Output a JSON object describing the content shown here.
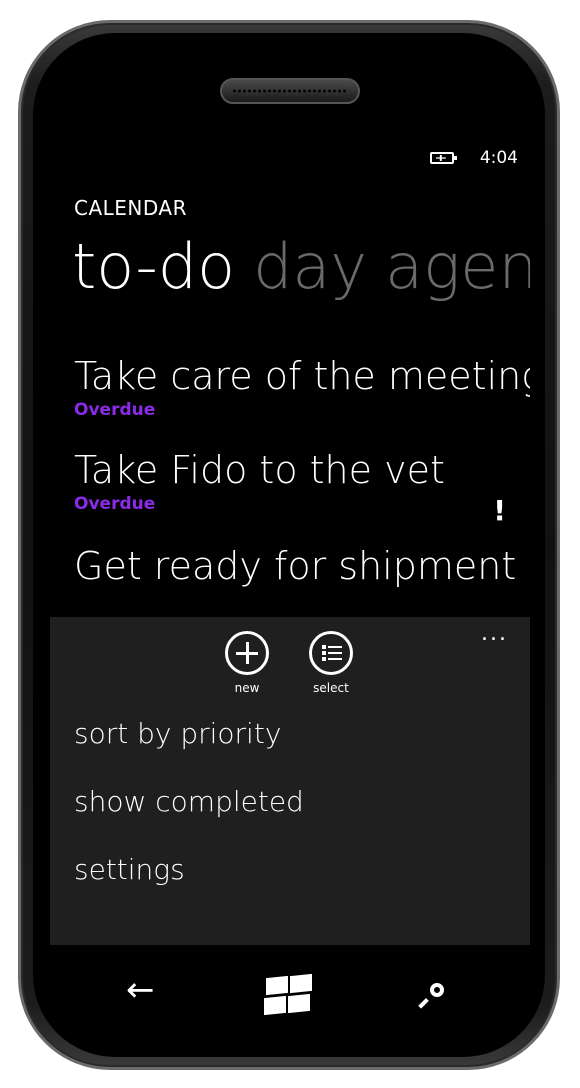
{
  "status_bar": {
    "battery_icon": "battery-charging-icon",
    "time": "4:04"
  },
  "app": {
    "title": "CALENDAR"
  },
  "pivots": [
    {
      "label": "to-do",
      "active": true
    },
    {
      "label": "day",
      "active": false
    },
    {
      "label": "agen",
      "active": false
    }
  ],
  "tasks": [
    {
      "title": "Take care of the meeting f",
      "status": "Overdue",
      "high_priority": false
    },
    {
      "title": "Take Fido to the vet",
      "status": "Overdue",
      "high_priority": true,
      "priority_mark": "!"
    },
    {
      "title": "Get ready for shipment",
      "status": "",
      "high_priority": false
    }
  ],
  "app_bar": {
    "more": "...",
    "buttons": [
      {
        "label": "new",
        "icon": "plus-icon"
      },
      {
        "label": "select",
        "icon": "list-icon"
      }
    ],
    "menu_items": [
      "sort by priority",
      "show completed",
      "settings"
    ]
  },
  "hardware_buttons": {
    "back": "←",
    "start": "windows-logo-icon",
    "search": "search-icon"
  },
  "colors": {
    "accent": "#8b2be8",
    "background": "#000000",
    "app_bar": "#1f1f1f",
    "inactive_pivot": "#6a6a6a"
  }
}
